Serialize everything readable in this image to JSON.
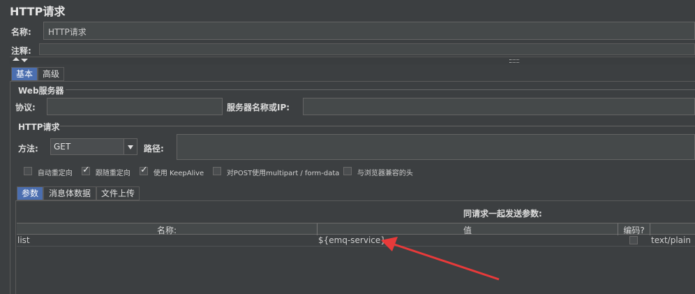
{
  "window": {
    "title": "HTTP请求"
  },
  "name_row": {
    "label": "名称:",
    "value": "HTTP请求"
  },
  "comment_row": {
    "label": "注释:"
  },
  "top_tabs": [
    {
      "label": "基本",
      "active": true
    },
    {
      "label": "高级",
      "active": false
    }
  ],
  "web_server": {
    "legend": "Web服务器",
    "protocol_label": "协议:",
    "server_label": "服务器名称或IP:",
    "protocol_value": "",
    "server_value": ""
  },
  "http_request": {
    "legend": "HTTP请求",
    "method_label": "方法:",
    "method_value": "GET",
    "path_label": "路径:",
    "path_value": ""
  },
  "options": [
    {
      "label": "自动重定向",
      "checked": false
    },
    {
      "label": "跟随重定向",
      "checked": true
    },
    {
      "label": "使用 KeepAlive",
      "checked": true
    },
    {
      "label": "对POST使用multipart / form-data",
      "checked": false
    },
    {
      "label": "与浏览器兼容的头",
      "checked": false
    }
  ],
  "param_tabs": [
    {
      "label": "参数",
      "active": true
    },
    {
      "label": "消息体数据",
      "active": false
    },
    {
      "label": "文件上传",
      "active": false
    }
  ],
  "params_title": "同请求一起发送参数:",
  "table": {
    "headers": {
      "name": "名称:",
      "value": "值",
      "encode": "编码?",
      "type": ""
    },
    "rows": [
      {
        "name": "list",
        "value": "${emq-service}",
        "encode": false,
        "type": "text/plain"
      }
    ]
  },
  "colors": {
    "background": "#3c3f41",
    "tab_active": "#4b6eaf",
    "arrow": "#e83a3a"
  }
}
